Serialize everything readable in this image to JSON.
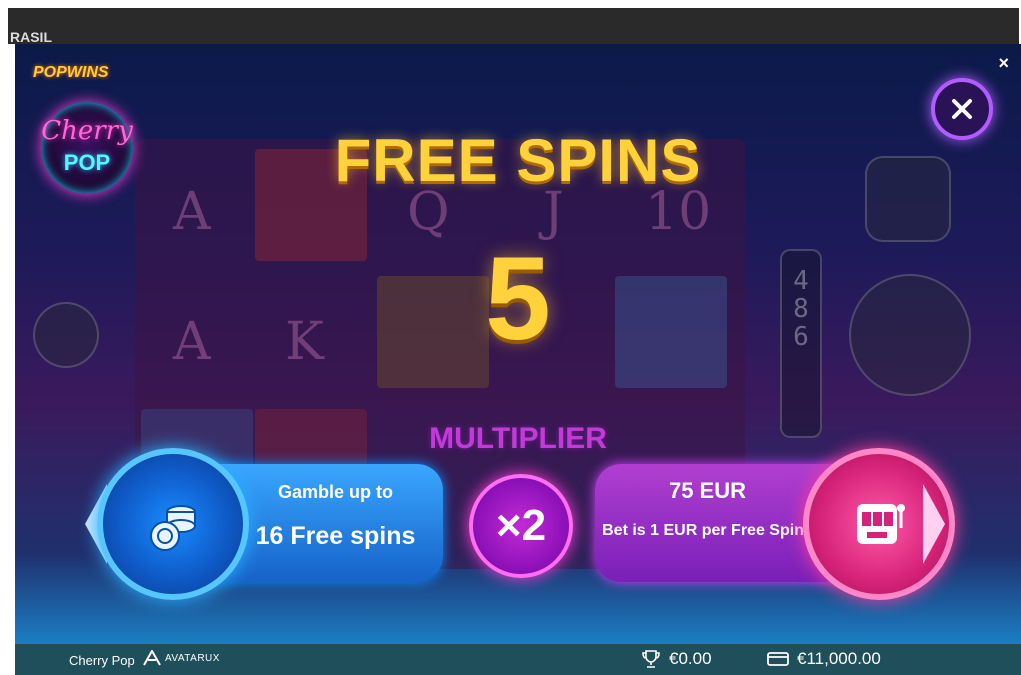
{
  "top_strip": {
    "site_text": "RASIL"
  },
  "overlay": {
    "close_symbol": "×"
  },
  "background_reels": {
    "row1": [
      "A",
      "Q",
      "J",
      "10"
    ],
    "row2": [
      "A",
      "K"
    ],
    "bet_counter_digits": "4\n8\n6"
  },
  "logo": {
    "brand_text": "POPWINS",
    "game_word_1": "Cherry",
    "game_word_2": "POP"
  },
  "popup": {
    "title": "FREE SPINS",
    "spins_count": "5",
    "multiplier_label": "MULTIPLIER",
    "gamble_line1": "Gamble up to",
    "gamble_line2": "16 Free spins",
    "multiplier_value": "×2",
    "cost_amount": "75 EUR",
    "cost_note": "Bet is 1 EUR per Free Spins"
  },
  "footer": {
    "game_name": "Cherry Pop",
    "provider": "AVATARUX",
    "win_amount": "€0.00",
    "balance": "€11,000.00"
  },
  "icons": [
    "close-icon",
    "poker-chips-icon",
    "slot-machine-icon",
    "trophy-icon",
    "wallet-icon",
    "avatarux-logo-icon"
  ],
  "colors": {
    "gold": "#ffd23c",
    "blue_panel": "#1f7fe0",
    "purple_panel": "#9a2fc8",
    "multiplier_pink": "#c23bd6",
    "footer": "#1f4f5a"
  }
}
